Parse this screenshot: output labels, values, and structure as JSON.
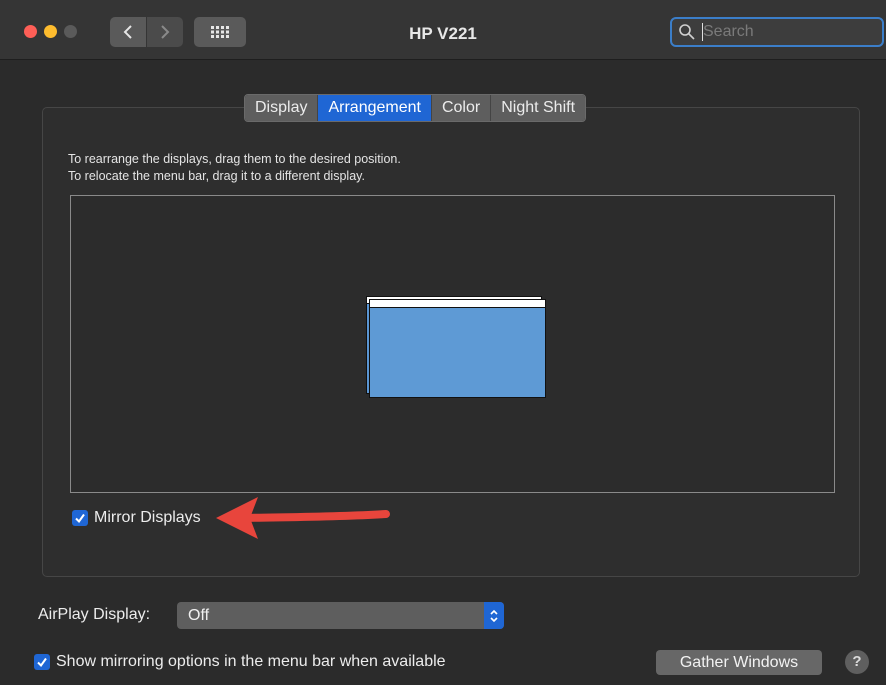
{
  "window": {
    "title": "HP V221"
  },
  "toolbar": {
    "back_icon": "chevron-left-icon",
    "forward_icon": "chevron-right-icon",
    "grid_icon": "grid-icon",
    "search": {
      "placeholder": "Search",
      "value": ""
    }
  },
  "tabs": [
    {
      "label": "Display",
      "active": false
    },
    {
      "label": "Arrangement",
      "active": true
    },
    {
      "label": "Color",
      "active": false
    },
    {
      "label": "Night Shift",
      "active": false
    }
  ],
  "arrangement": {
    "instruction_1": "To rearrange the displays, drag them to the desired position.",
    "instruction_2": "To relocate the menu bar, drag it to a different display.",
    "mirror_label": "Mirror Displays",
    "mirror_checked": true
  },
  "airplay": {
    "label": "AirPlay Display:",
    "value": "Off"
  },
  "footer": {
    "show_mirroring_label": "Show mirroring options in the menu bar when available",
    "show_mirroring_checked": true,
    "gather_button": "Gather Windows",
    "help": "?"
  },
  "colors": {
    "accent": "#1f66d4",
    "display_fill": "#5e9ad5",
    "annotation_arrow": "#e8453c"
  }
}
